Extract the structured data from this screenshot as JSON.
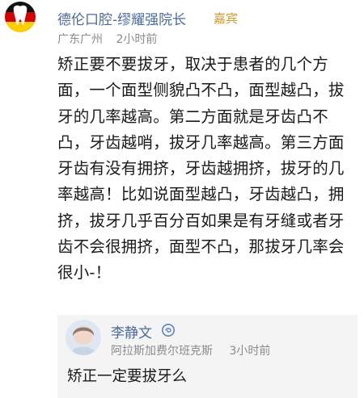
{
  "post": {
    "author": {
      "name": "德伦口腔-缪耀强院长",
      "badge": "嘉宾",
      "avatar_icon": "tooth-flag-icon"
    },
    "location": "广东广州",
    "time": "2小时前",
    "content": "矫正要不要拔牙，取决于患者的几个方面，一个面型侧貌凸不凸，面型越凸，拔牙的几率越高。第二方面就是牙齿凸不凸，牙齿越哨，拔牙几率越高。第三方面牙齿有没有拥挤，牙齿越拥挤，拔牙的几率越高！比如说面型越凸，牙齿越凸，拥挤，拔牙几乎百分百如果是有牙缝或者牙齿不会很拥挤，面型不凸，那拔牙几率会很小-！"
  },
  "reply": {
    "author": "李静文",
    "author_icon": "verified-swirl-icon",
    "location": "阿拉斯加费尔班克斯",
    "time": "3小时前",
    "text": "矫正一定要拔牙么"
  },
  "colors": {
    "name": "#4b6b9a",
    "badge": "#d39a2e",
    "meta": "#8b8b8b",
    "reply_bg": "#f4f4f4"
  }
}
